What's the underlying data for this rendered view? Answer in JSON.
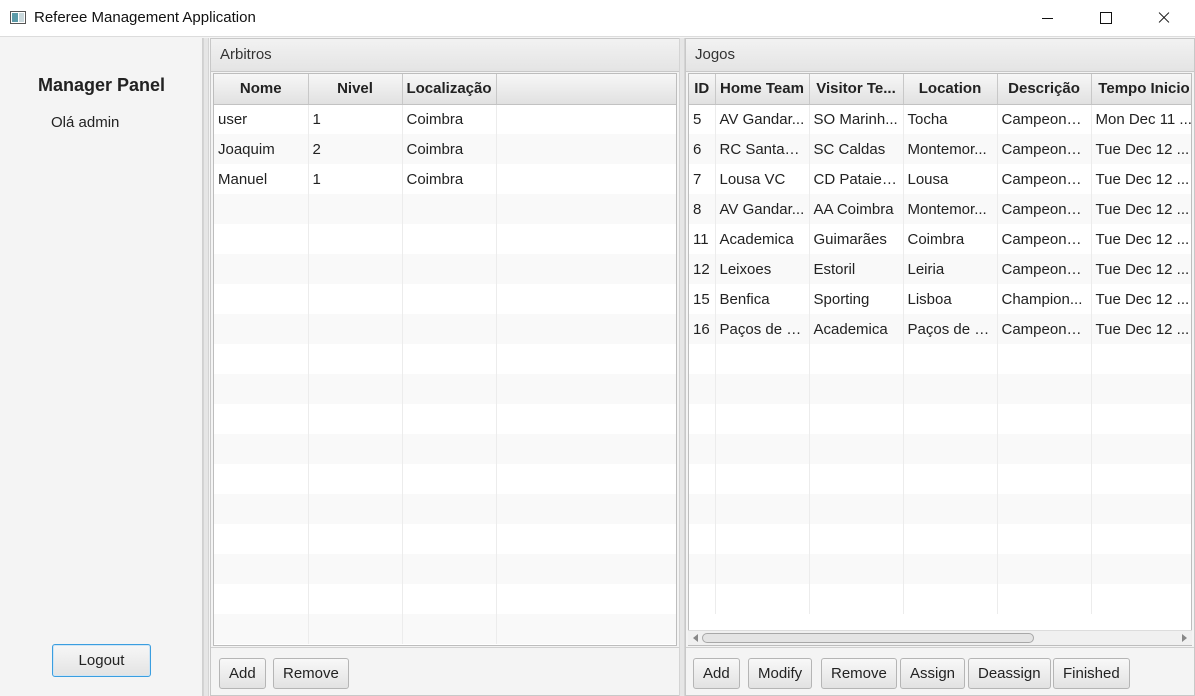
{
  "window": {
    "title": "Referee Management Application"
  },
  "manager": {
    "title": "Manager Panel",
    "greeting": "Olá admin",
    "logout_label": "Logout"
  },
  "arbitros": {
    "title": "Arbitros",
    "columns": [
      "Nome",
      "Nivel",
      "Localização"
    ],
    "rows": [
      [
        "user",
        "1",
        "Coimbra"
      ],
      [
        "Joaquim",
        "2",
        "Coimbra"
      ],
      [
        "Manuel",
        "1",
        "Coimbra"
      ]
    ],
    "buttons": {
      "add": "Add",
      "remove": "Remove"
    }
  },
  "jogos": {
    "title": "Jogos",
    "columns": [
      "ID",
      "Home Team",
      "Visitor Te...",
      "Location",
      "Descrição",
      "Tempo Inicio"
    ],
    "rows": [
      [
        "5",
        "AV Gandar...",
        "SO Marinh...",
        "Tocha",
        "Campeona...",
        "Mon Dec 11 ..."
      ],
      [
        "6",
        "RC Santarem",
        "SC Caldas",
        "Montemor...",
        "Campeona...",
        "Tue Dec 12 ..."
      ],
      [
        "7",
        "Lousa VC",
        "CD Pataien...",
        "Lousa",
        "Campeona...",
        "Tue Dec 12 ..."
      ],
      [
        "8",
        "AV Gandar...",
        "AA Coimbra",
        "Montemor...",
        "Campeona...",
        "Tue Dec 12 ..."
      ],
      [
        "11",
        "Academica",
        "Guimarães",
        "Coimbra",
        "Campeona...",
        "Tue Dec 12 ..."
      ],
      [
        "12",
        "Leixoes",
        "Estoril",
        "Leiria",
        "Campeona...",
        "Tue Dec 12 ..."
      ],
      [
        "15",
        "Benfica",
        "Sporting",
        "Lisboa",
        "Champion...",
        "Tue Dec 12 ..."
      ],
      [
        "16",
        "Paços de F...",
        "Academica",
        "Paços de F...",
        "Campeona...",
        "Tue Dec 12 ..."
      ]
    ],
    "buttons": {
      "add": "Add",
      "modify": "Modify",
      "remove": "Remove",
      "assign": "Assign",
      "deassign": "Deassign",
      "finished": "Finished"
    }
  }
}
